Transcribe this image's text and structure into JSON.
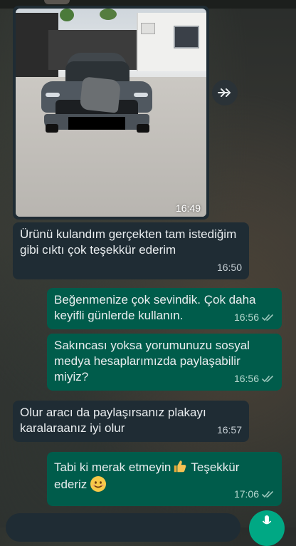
{
  "chat": {
    "image_message": {
      "time": "16:49"
    },
    "messages": [
      {
        "direction": "incoming",
        "text": "Ürünü kulandım gerçekten tam istediğim gibi cıktı çok teşekkür ederim",
        "time": "16:50"
      },
      {
        "direction": "outgoing",
        "text": "Beğenmenize çok sevindik. Çok daha keyifli günlerde kullanın.",
        "time": "16:56",
        "status": "read"
      },
      {
        "direction": "outgoing",
        "text": "Sakıncası yoksa yorumunuzu sosyal medya hesaplarımızda paylaşabilir miyiz?",
        "time": "16:56",
        "status": "read"
      },
      {
        "direction": "incoming",
        "text": "Olur aracı da paylaşırsanız plakayı karalaraanız iyi olur",
        "time": "16:57"
      },
      {
        "direction": "outgoing",
        "text_part1": "Tabi ki merak etmeyin",
        "text_part2": "Teşekkür ederiz",
        "time": "17:06",
        "status": "read"
      }
    ]
  },
  "icons": {
    "forward": "forward-icon",
    "read_receipt": "double-check-icon",
    "thumbs_up": "thumbs-up-emoji",
    "smile": "smiling-face-emoji",
    "mic": "mic-icon"
  },
  "colors": {
    "incoming_bubble": "#1f2c34",
    "outgoing_bubble": "#005c4b",
    "accent": "#00a884",
    "text": "#e9edef"
  }
}
